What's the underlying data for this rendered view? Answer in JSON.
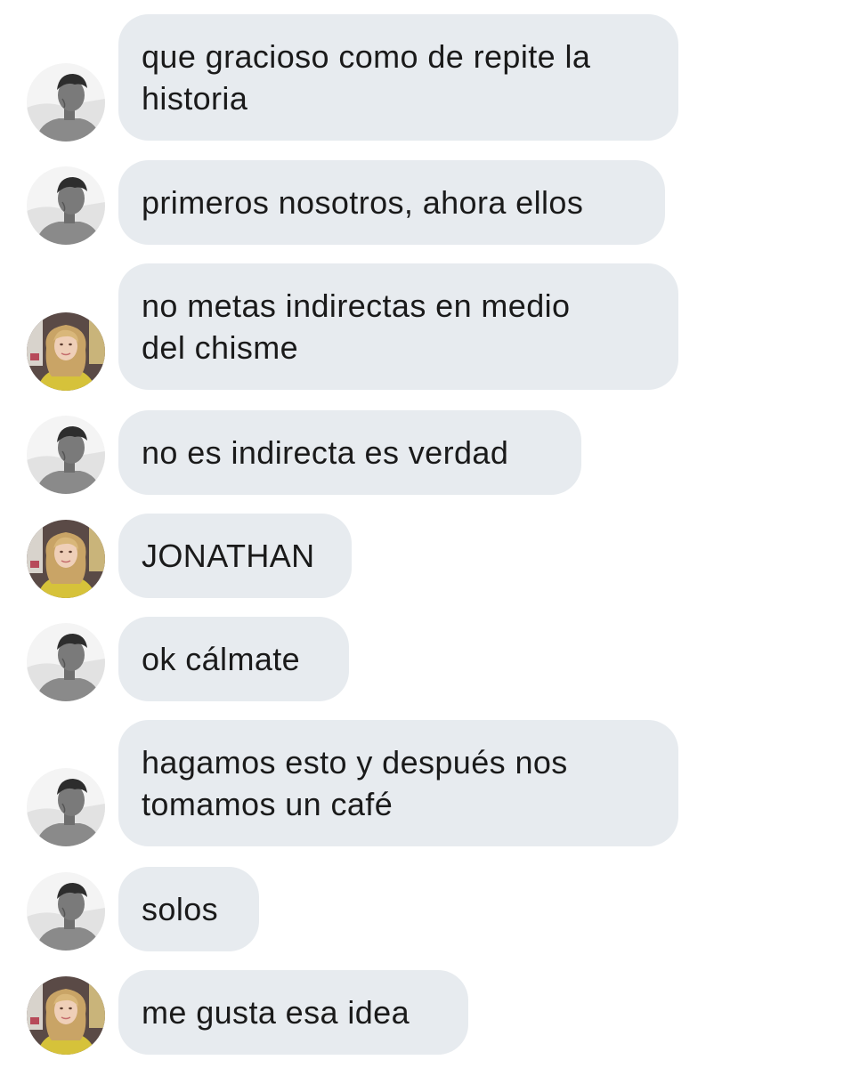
{
  "conversation": {
    "messages": [
      {
        "sender": "jonathan",
        "text": "que gracioso como de repite la\nhistoria"
      },
      {
        "sender": "jonathan",
        "text": "primeros nosotros, ahora ellos"
      },
      {
        "sender": "girl",
        "text": "no metas indirectas en medio\ndel chisme"
      },
      {
        "sender": "jonathan",
        "text": "no es indirecta es verdad"
      },
      {
        "sender": "girl",
        "text": "JONATHAN"
      },
      {
        "sender": "jonathan",
        "text": "ok cálmate"
      },
      {
        "sender": "jonathan",
        "text": "hagamos esto y después nos\ntomamos un café"
      },
      {
        "sender": "jonathan",
        "text": "solos"
      },
      {
        "sender": "girl",
        "text": "me gusta esa idea"
      }
    ]
  },
  "colors": {
    "bubble_background": "#e7ebef",
    "message_text": "#1a1a1a",
    "page_background": "#ffffff"
  },
  "icons": {
    "jonathan_avatar": "grayscale-profile-photo-boy",
    "girl_avatar": "blonde-girl-yellow-sweater-photo"
  }
}
